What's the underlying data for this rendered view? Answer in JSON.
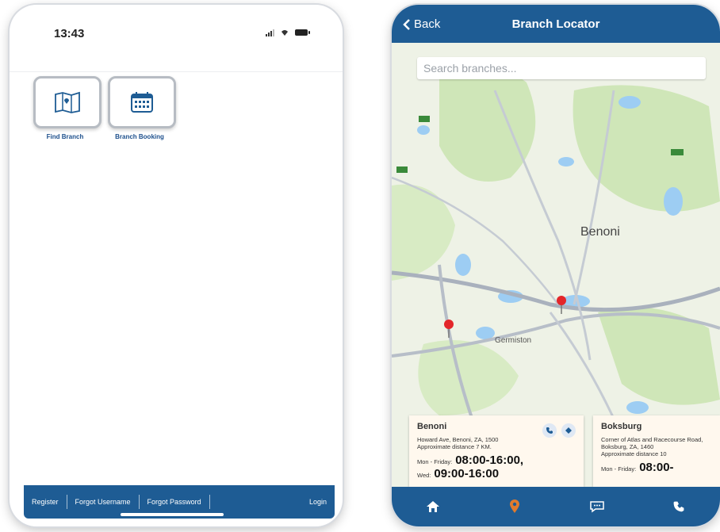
{
  "left_screen": {
    "status_time": "13:43",
    "tiles": [
      {
        "label": "Find Branch",
        "icon": "map-icon"
      },
      {
        "label": "Branch Booking",
        "icon": "calendar-icon"
      }
    ],
    "bottom_nav": [
      "Register",
      "Forgot Username",
      "Forgot Password",
      "Login"
    ]
  },
  "right_screen": {
    "nav": {
      "back_label": "Back",
      "title": "Branch Locator"
    },
    "search_placeholder": "Search branches...",
    "map": {
      "city_main": "Benoni",
      "city_secondary": "Germiston"
    },
    "cards": [
      {
        "name": "Benoni",
        "address": "Howard Ave, Benoni, ZA, 1500",
        "distance": "Approximate distance 7 KM.",
        "hours_weekday_label": "Mon - Friday:",
        "hours_weekday": "08:00-16:00,",
        "hours_wed_label": "Wed:",
        "hours_wed": "09:00-16:00"
      },
      {
        "name": "Boksburg",
        "address": "Corner of Atlas and Racecourse Road, Boksburg, ZA, 1460",
        "distance": "Approximate distance 10",
        "hours_weekday_label": "Mon - Friday:",
        "hours_weekday": "08:00-"
      }
    ],
    "tab_icons": [
      "home-icon",
      "location-pin-icon",
      "chat-icon",
      "phone-icon"
    ],
    "colors": {
      "brand_blue": "#1e5c94",
      "active_tab": "#e07b2d"
    }
  }
}
